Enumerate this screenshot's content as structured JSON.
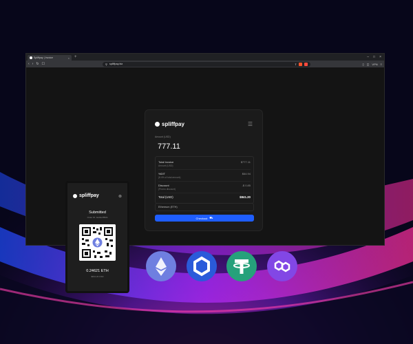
{
  "browser": {
    "tab_title": "Spliffpay | Invoice",
    "new_tab": "+",
    "url": "spliffpay.biz",
    "vpn_label": "VPN"
  },
  "card": {
    "brand": "spliffpay",
    "amount_label": "Amount (USD)",
    "amount_value": "777.11",
    "rows": [
      {
        "label": "Total Invoice",
        "sublabel": "Amount (USD)",
        "value": "$777.11"
      },
      {
        "label": "%DIT",
        "sublabel": "(8.4% of total amount)",
        "value": "$64.94"
      },
      {
        "label": "Discount",
        "sublabel": "(Promo discount)",
        "value": "-$ 0.85"
      }
    ],
    "total_label": "Total (USD)",
    "total_value": "$841.20",
    "network": "Ethereum (ETH)",
    "checkout_label": "Checkout"
  },
  "phone": {
    "brand": "spliffpay",
    "status": "Submitted",
    "order_id": "Order ID: 3a4be3f5f0b",
    "eth_amount": "0.24621 ETH",
    "usd_amount": "$841.20 USD"
  },
  "coins": [
    {
      "name": "ethereum-icon",
      "color": "#6f7fe0"
    },
    {
      "name": "chainlink-icon",
      "color": "#2a5ada"
    },
    {
      "name": "tether-icon",
      "color": "#26a17b"
    },
    {
      "name": "polygon-icon",
      "color": "#8247e5"
    }
  ]
}
